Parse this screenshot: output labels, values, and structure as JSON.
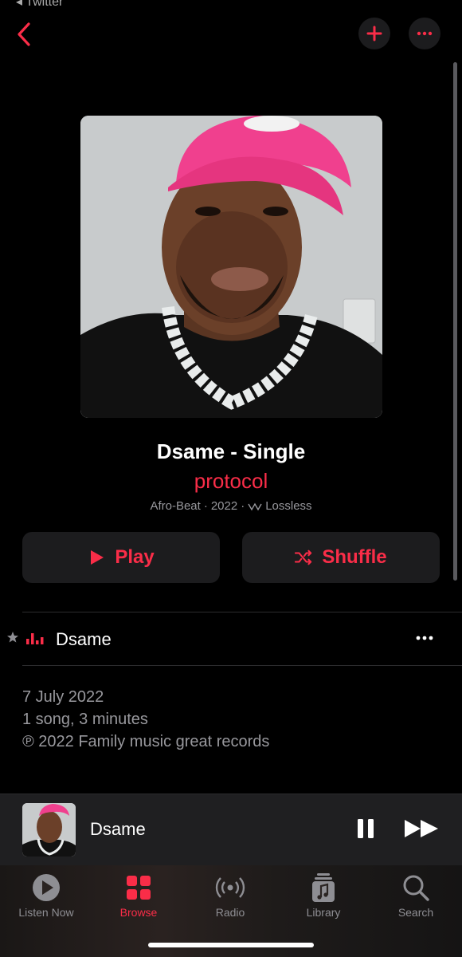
{
  "status": {
    "back_label": "◂ Twitter"
  },
  "header": {
    "back_icon": "chevron-left-icon",
    "add_icon": "plus-icon",
    "more_icon": "ellipsis-icon"
  },
  "album": {
    "title": "Dsame - Single",
    "artist": "protocol",
    "genre": "Afro-Beat",
    "year": "2022",
    "quality": "Lossless",
    "separator": "·"
  },
  "actions": {
    "play_label": "Play",
    "shuffle_label": "Shuffle"
  },
  "tracks": [
    {
      "title": "Dsame",
      "favorite": true,
      "playing": true
    }
  ],
  "info": {
    "release_date": "7 July 2022",
    "summary": "1 song, 3 minutes",
    "copyright": "℗ 2022 Family music great records"
  },
  "mini_player": {
    "title": "Dsame",
    "state": "playing"
  },
  "tabs": [
    {
      "label": "Listen Now",
      "icon": "play-circle-icon",
      "active": false
    },
    {
      "label": "Browse",
      "icon": "grid-icon",
      "active": true
    },
    {
      "label": "Radio",
      "icon": "radio-waves-icon",
      "active": false
    },
    {
      "label": "Library",
      "icon": "music-library-icon",
      "active": false
    },
    {
      "label": "Search",
      "icon": "magnifier-icon",
      "active": false
    }
  ],
  "colors": {
    "accent": "#fa2d48",
    "background": "#000000",
    "secondary_text": "#98989d"
  }
}
